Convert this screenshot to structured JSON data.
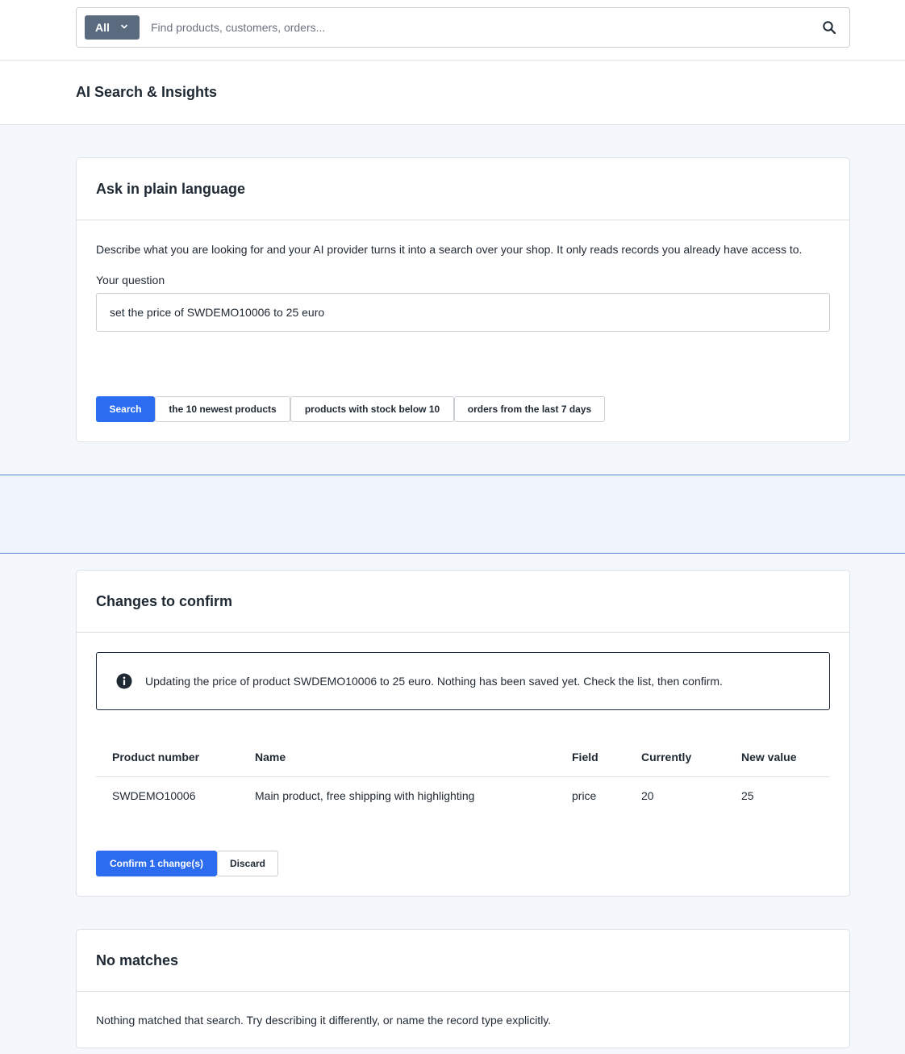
{
  "search": {
    "type_label": "All",
    "placeholder": "Find products, customers, orders..."
  },
  "page": {
    "title": "AI Search & Insights"
  },
  "ask": {
    "title": "Ask in plain language",
    "description": "Describe what you are looking for and your AI provider turns it into a search over your shop. It only reads records you already have access to.",
    "question_label": "Your question",
    "question_value": "set the price of SWDEMO10006 to 25 euro",
    "search_button": "Search",
    "suggestions": [
      "the 10 newest products",
      "products with stock below 10",
      "orders from the last 7 days"
    ]
  },
  "changes": {
    "title": "Changes to confirm",
    "notice": "Updating the price of product SWDEMO10006 to 25 euro. Nothing has been saved yet. Check the list, then confirm.",
    "columns": [
      "Product number",
      "Name",
      "Field",
      "Currently",
      "New value"
    ],
    "rows": [
      [
        "SWDEMO10006",
        "Main product, free shipping with highlighting",
        "price",
        "20",
        "25"
      ]
    ],
    "confirm_button": "Confirm 1 change(s)",
    "discard_button": "Discard"
  },
  "nomatch": {
    "title": "No matches",
    "text": "Nothing matched that search. Try describing it differently, or name the record type explicitly."
  },
  "colors": {
    "accent": "#2b6cf0",
    "type_button": "#5b6b7f"
  },
  "icons": [
    "chevron-down-icon",
    "search-icon",
    "info-icon"
  ]
}
